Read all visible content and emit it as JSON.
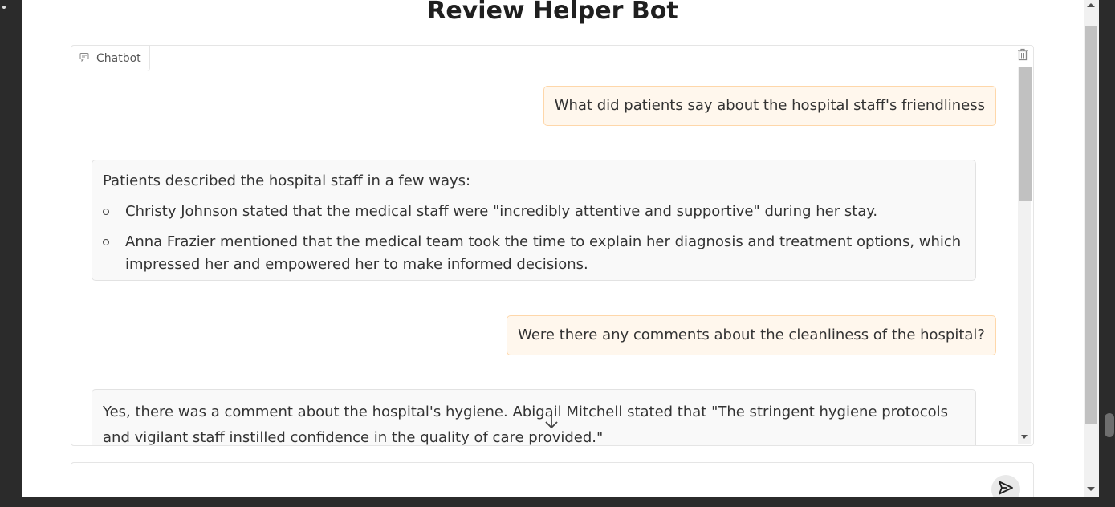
{
  "page": {
    "title": "Review Helper Bot"
  },
  "chatbot": {
    "label": "Chatbot",
    "clear_icon": "trash-icon",
    "messages": [
      {
        "role": "user",
        "text": "What did patients say about the hospital staff's friendliness"
      },
      {
        "role": "bot",
        "intro": "Patients described the hospital staff in a few ways:",
        "bullets": [
          "Christy Johnson stated that the medical staff were \"incredibly attentive and supportive\" during her stay.",
          "Anna Frazier mentioned that the medical team took the time to explain her diagnosis and treatment options, which impressed her and empowered her to make informed decisions."
        ]
      },
      {
        "role": "user",
        "text": "Were there any comments about the cleanliness of the hospital?"
      },
      {
        "role": "bot",
        "text": "Yes, there was a comment about the hospital's hygiene. Abigail Mitchell stated that \"The stringent hygiene protocols and vigilant staff instilled confidence in the quality of care provided.\""
      }
    ]
  },
  "input": {
    "placeholder": "",
    "value": "",
    "send_icon": "send-icon"
  },
  "colors": {
    "user_bubble_bg": "#fff7ed",
    "user_bubble_border": "#fed7aa",
    "bot_bubble_bg": "#f9f9f9"
  }
}
